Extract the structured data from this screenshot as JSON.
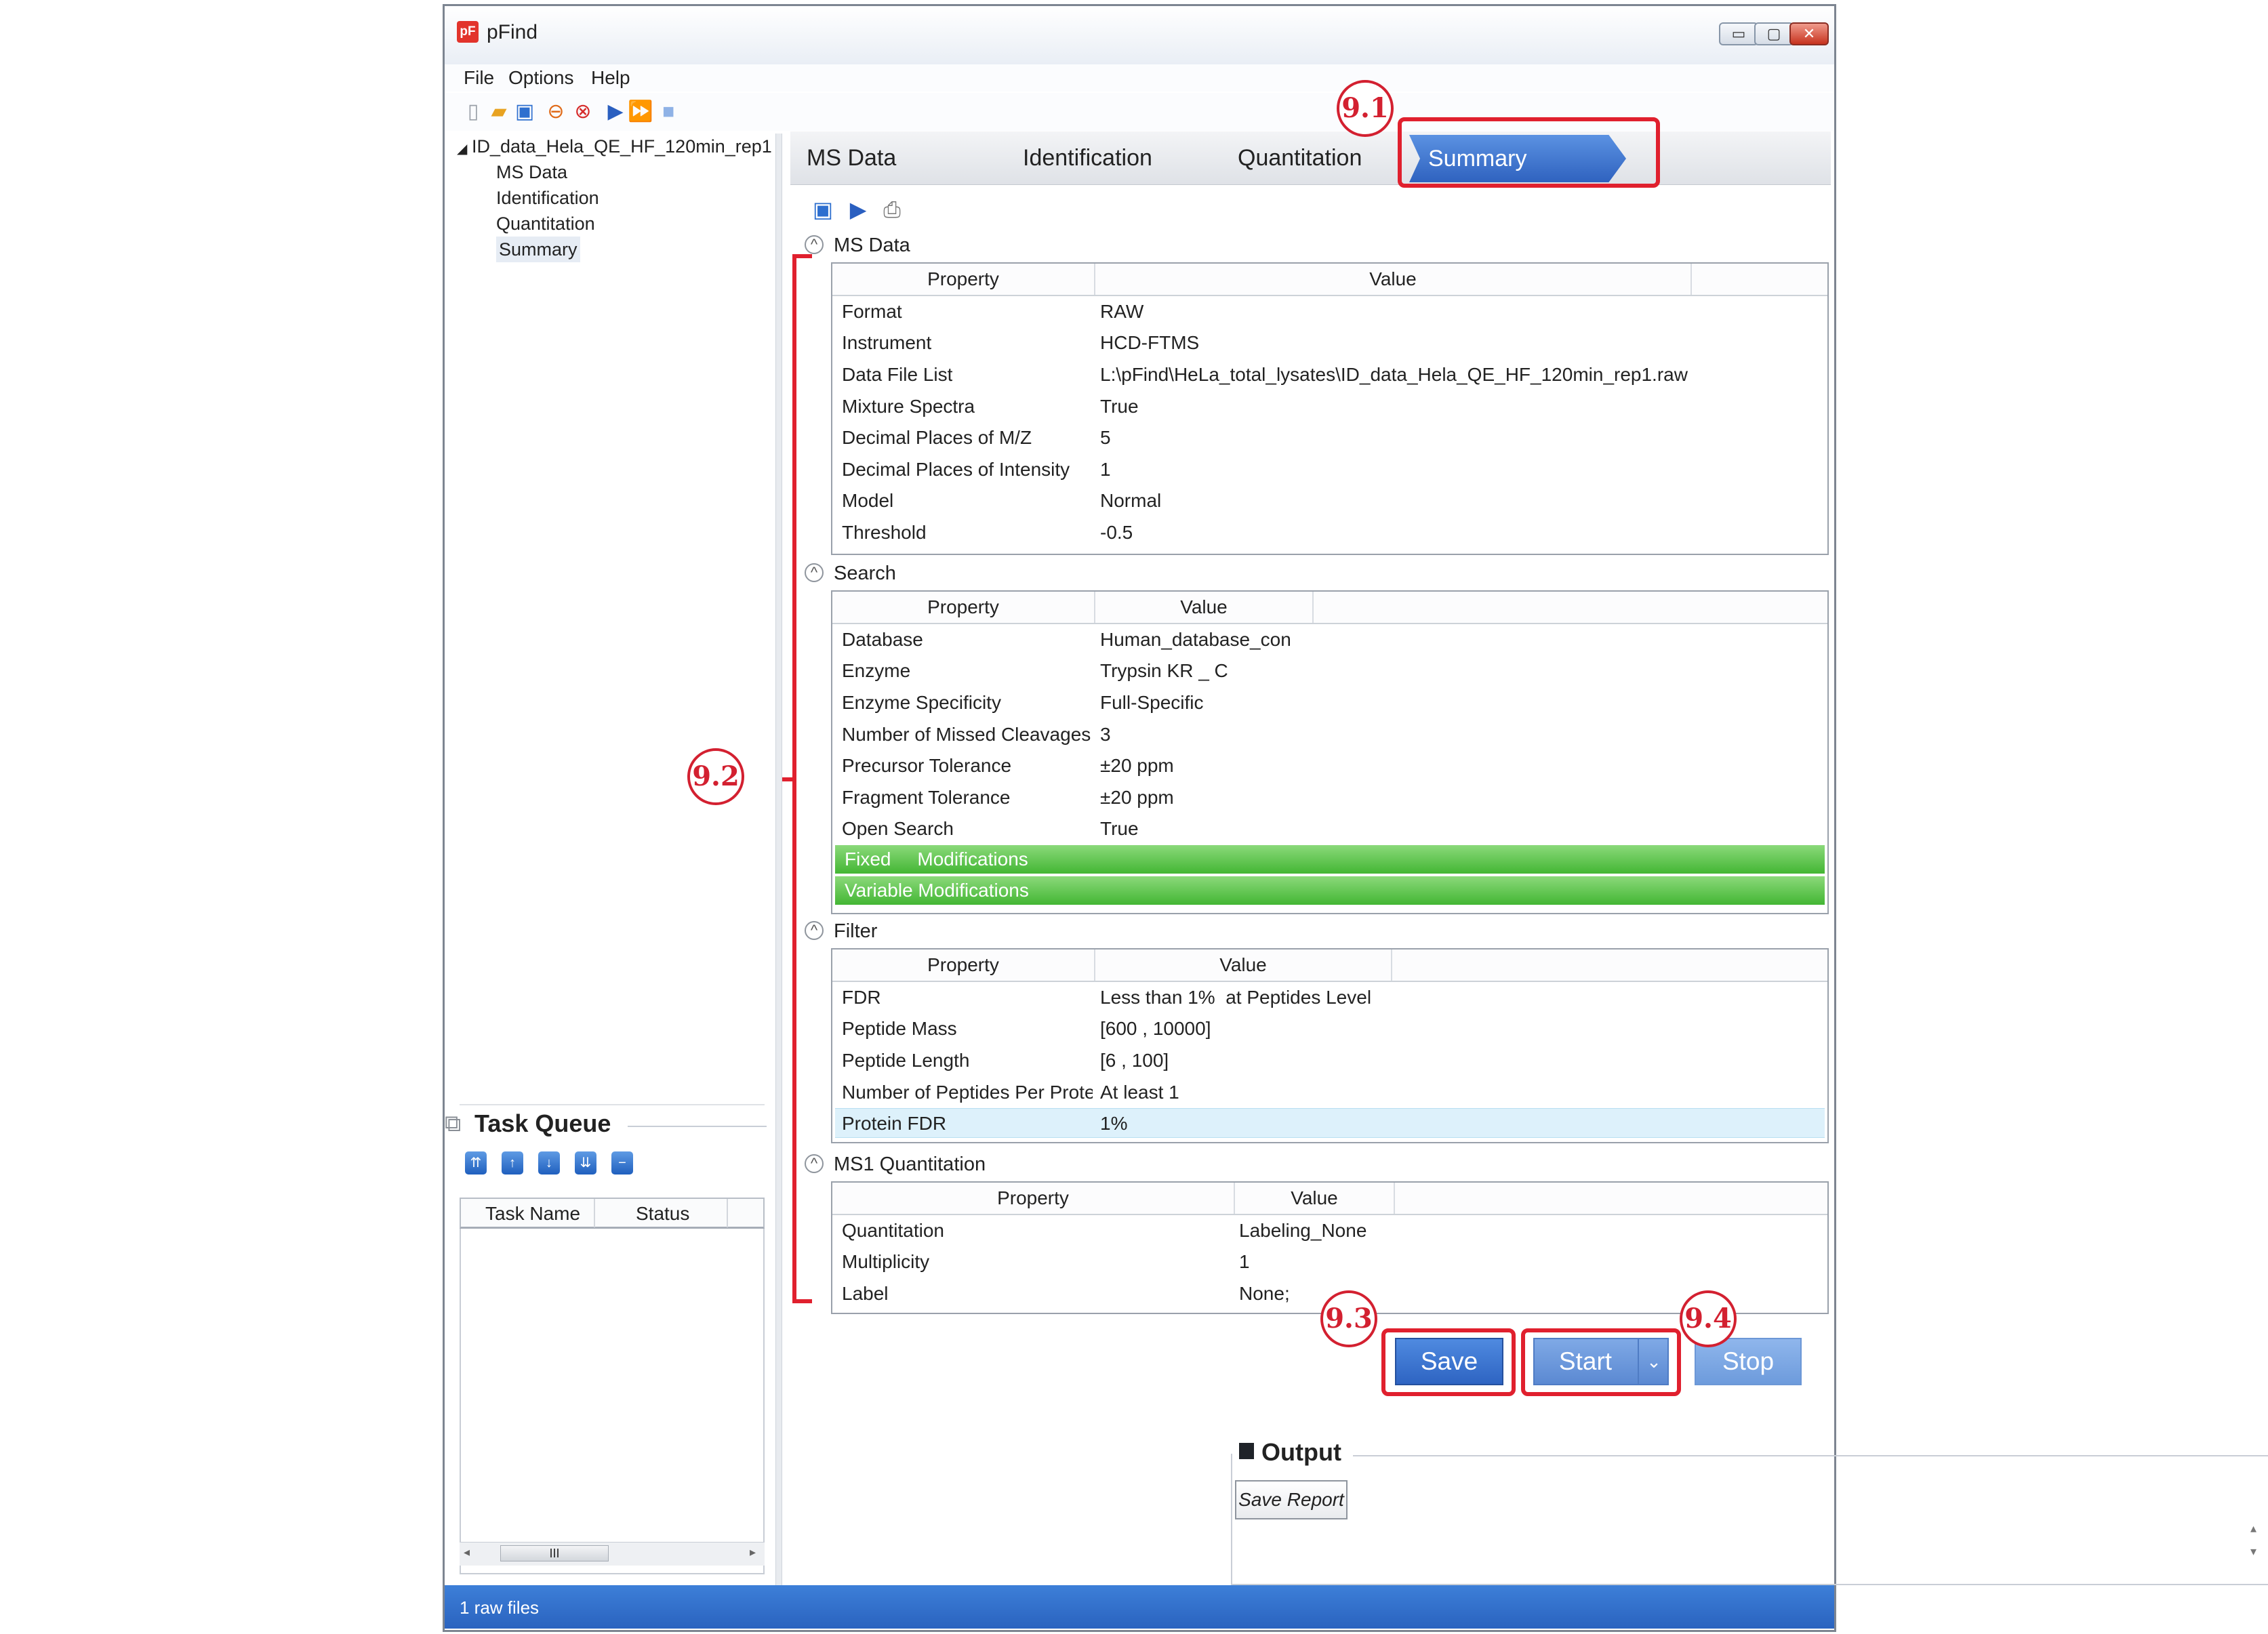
{
  "window": {
    "title": "pFind",
    "logo": "pF",
    "minimize": "▭",
    "maximize": "▢",
    "close": "✕"
  },
  "menu": [
    "File",
    "Options",
    "Help"
  ],
  "tree": {
    "root": "ID_data_Hela_QE_HF_120min_rep1",
    "children": [
      "MS Data",
      "Identification",
      "Quantitation",
      "Summary"
    ]
  },
  "task_queue": {
    "title": "Task Queue",
    "columns": [
      "Task Name",
      "Status"
    ],
    "scroll_thumb": "III"
  },
  "tabs": [
    "MS Data",
    "Identification",
    "Quantitation",
    "Summary"
  ],
  "active_tab": "Summary",
  "sections": {
    "ms_data": {
      "title": "MS Data",
      "headers": [
        "Property",
        "Value"
      ],
      "rows": [
        [
          "Format",
          "RAW"
        ],
        [
          "Instrument",
          "HCD-FTMS"
        ],
        [
          "Data File List",
          "L:\\pFind\\HeLa_total_lysates\\ID_data_Hela_QE_HF_120min_rep1.raw"
        ],
        [
          "Mixture Spectra",
          "True"
        ],
        [
          "Decimal Places of M/Z",
          "5"
        ],
        [
          "Decimal Places of Intensity",
          "1"
        ],
        [
          "Model",
          "Normal"
        ],
        [
          "Threshold",
          "-0.5"
        ]
      ]
    },
    "search": {
      "title": "Search",
      "headers": [
        "Property",
        "Value"
      ],
      "rows": [
        [
          "Database",
          "Human_database_con"
        ],
        [
          "Enzyme",
          "Trypsin KR _ C"
        ],
        [
          "Enzyme Specificity",
          "Full-Specific"
        ],
        [
          "Number of Missed Cleavages",
          "3"
        ],
        [
          "Precursor Tolerance",
          "±20 ppm"
        ],
        [
          "Fragment Tolerance",
          "±20 ppm"
        ],
        [
          "Open Search",
          "True"
        ]
      ],
      "fixed_mods": "Fixed     Modifications",
      "variable_mods": "Variable Modifications"
    },
    "filter": {
      "title": "Filter",
      "headers": [
        "Property",
        "Value"
      ],
      "rows": [
        [
          "FDR",
          "Less than 1%  at Peptides Level"
        ],
        [
          "Peptide Mass",
          "[600 , 10000]"
        ],
        [
          "Peptide Length",
          "[6 , 100]"
        ],
        [
          "Number of Peptides Per Protein",
          "At least 1"
        ],
        [
          "Protein FDR",
          "1%"
        ]
      ]
    },
    "ms1_quant": {
      "title": "MS1 Quantitation",
      "headers": [
        "Property",
        "Value"
      ],
      "rows": [
        [
          "Quantitation",
          "Labeling_None"
        ],
        [
          "Multiplicity",
          "1"
        ],
        [
          "Label",
          "None;"
        ]
      ]
    }
  },
  "buttons": {
    "save": "Save",
    "start": "Start",
    "start_dropdown": "⌄",
    "stop": "Stop"
  },
  "output": {
    "title": "Output",
    "save_report": "Save Report"
  },
  "status": "1 raw files",
  "annotations": [
    "9.1",
    "9.2",
    "9.3",
    "9.4"
  ],
  "colors": {
    "accent": "#2f62bf",
    "annotation": "#e0202e",
    "highlight_green": "#43b634",
    "highlight_blue": "#ddf1fb"
  },
  "icons": {
    "toolbar": [
      "new-file-icon",
      "open-folder-icon",
      "save-icon",
      "stop-circle-icon",
      "cancel-icon",
      "run-icon",
      "run-all-icon",
      "stop-square-icon"
    ],
    "summary_toolbar": [
      "save-icon",
      "run-icon",
      "print-icon"
    ],
    "task_queue": [
      "move-top-icon",
      "move-up-icon",
      "move-down-icon",
      "move-bottom-icon",
      "remove-icon"
    ]
  }
}
